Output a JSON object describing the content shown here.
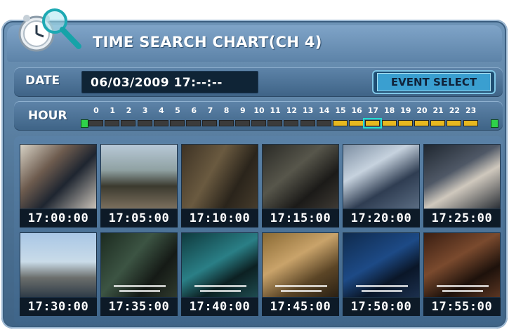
{
  "header": {
    "title": "TIME SEARCH CHART(CH 4)",
    "logo_icon": "clock-magnifier-icon"
  },
  "date": {
    "label": "DATE",
    "value": "06/03/2009 17:--:--"
  },
  "event_button": {
    "label": "EVENT SELECT"
  },
  "hour": {
    "label": "HOUR",
    "numbers": [
      "0",
      "1",
      "2",
      "3",
      "4",
      "5",
      "6",
      "7",
      "8",
      "9",
      "10",
      "11",
      "12",
      "13",
      "14",
      "15",
      "16",
      "17",
      "18",
      "19",
      "20",
      "21",
      "22",
      "23"
    ],
    "recorded_hours": [
      15,
      16,
      17,
      18,
      19,
      20,
      21,
      22,
      23
    ],
    "selected_hour": 17
  },
  "thumbnails": [
    {
      "time": "17:00:00"
    },
    {
      "time": "17:05:00"
    },
    {
      "time": "17:10:00"
    },
    {
      "time": "17:15:00"
    },
    {
      "time": "17:20:00"
    },
    {
      "time": "17:25:00"
    },
    {
      "time": "17:30:00"
    },
    {
      "time": "17:35:00"
    },
    {
      "time": "17:40:00"
    },
    {
      "time": "17:45:00"
    },
    {
      "time": "17:50:00"
    },
    {
      "time": "17:55:00"
    }
  ],
  "colors": {
    "recorded": "#e7b81f",
    "empty": "#3b3b3b",
    "selected_outline": "#22e0d0",
    "end_marker": "#2fd14a"
  }
}
